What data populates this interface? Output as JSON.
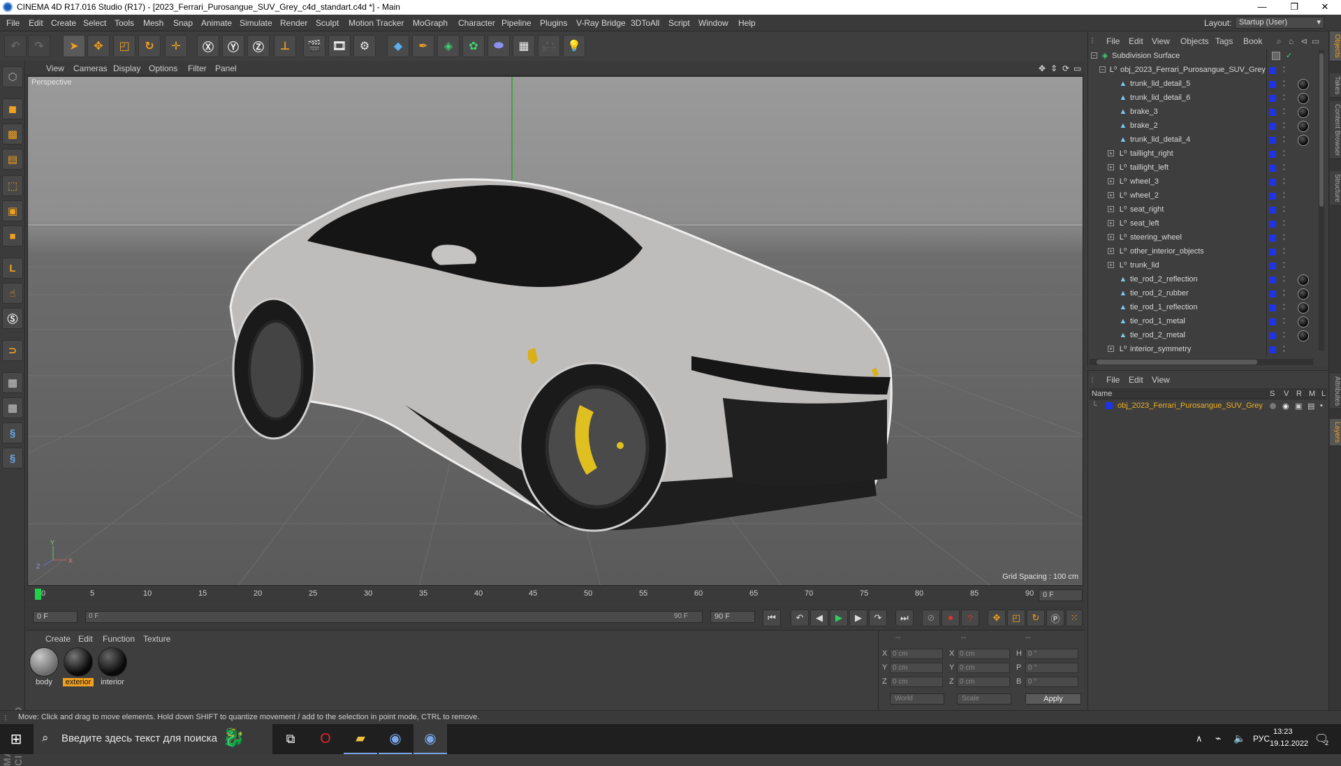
{
  "window": {
    "title": "CINEMA 4D R17.016 Studio (R17) - [2023_Ferrari_Purosangue_SUV_Grey_c4d_standart.c4d *] - Main",
    "minimize": "—",
    "maximize": "❐",
    "close": "✕"
  },
  "menu": [
    "File",
    "Edit",
    "Create",
    "Select",
    "Tools",
    "Mesh",
    "Snap",
    "Animate",
    "Simulate",
    "Render",
    "Sculpt",
    "Motion Tracker",
    "MoGraph",
    "Character",
    "Pipeline",
    "Plugins",
    "V-Ray Bridge",
    "3DToAll",
    "Script",
    "Window",
    "Help"
  ],
  "layout": {
    "label": "Layout:",
    "value": "Startup (User)"
  },
  "viewport": {
    "menu": [
      "View",
      "Cameras",
      "Display",
      "Options",
      "Filter",
      "Panel"
    ],
    "label": "Perspective",
    "grid_spacing": "Grid Spacing : 100 cm",
    "axis_y": "Y",
    "axis_x": "X",
    "axis_z": "Z"
  },
  "timeline": {
    "ticks": [
      "0",
      "5",
      "10",
      "15",
      "20",
      "25",
      "30",
      "35",
      "40",
      "45",
      "50",
      "55",
      "60",
      "65",
      "70",
      "75",
      "80",
      "85",
      "90"
    ],
    "current_frame": "0 F",
    "start_frame": "0 F",
    "range_start": "0 F",
    "range_end": "90 F",
    "end_frame": "90 F"
  },
  "materials": {
    "menu": [
      "Create",
      "Edit",
      "Function",
      "Texture"
    ],
    "items": [
      {
        "name": "body",
        "selected": false
      },
      {
        "name": "exterior",
        "selected": true
      },
      {
        "name": "interior",
        "selected": false
      }
    ]
  },
  "coordinates": {
    "header": [
      "--",
      "--",
      "--"
    ],
    "rows": [
      {
        "a": "X",
        "av": "0 cm",
        "b": "X",
        "bv": "0 cm",
        "c": "H",
        "cv": "0 °"
      },
      {
        "a": "Y",
        "av": "0 cm",
        "b": "Y",
        "bv": "0 cm",
        "c": "P",
        "cv": "0 °"
      },
      {
        "a": "Z",
        "av": "0 cm",
        "b": "Z",
        "bv": "0 cm",
        "c": "B",
        "cv": "0 °"
      }
    ],
    "mode": "World",
    "scale": "Scale",
    "apply": "Apply"
  },
  "status": "Move: Click and drag to move elements. Hold down SHIFT to quantize movement / add to the selection in point mode, CTRL to remove.",
  "object_manager": {
    "menu": [
      "File",
      "Edit",
      "View",
      "Objects",
      "Tags",
      "Book"
    ],
    "rows": [
      {
        "name": "Subdivision Surface",
        "indent": 0,
        "type": "subd",
        "expand": "−",
        "tag": false
      },
      {
        "name": "obj_2023_Ferrari_Purosangue_SUV_Grey",
        "indent": 1,
        "type": "null",
        "expand": "−",
        "tag": false
      },
      {
        "name": "trunk_lid_detail_5",
        "indent": 2,
        "type": "poly",
        "expand": "",
        "tag": true
      },
      {
        "name": "trunk_lid_detail_6",
        "indent": 2,
        "type": "poly",
        "expand": "",
        "tag": true
      },
      {
        "name": "brake_3",
        "indent": 2,
        "type": "poly",
        "expand": "",
        "tag": true
      },
      {
        "name": "brake_2",
        "indent": 2,
        "type": "poly",
        "expand": "",
        "tag": true
      },
      {
        "name": "trunk_lid_detail_4",
        "indent": 2,
        "type": "poly",
        "expand": "",
        "tag": true
      },
      {
        "name": "taillight_right",
        "indent": 2,
        "type": "null",
        "expand": "+",
        "tag": false
      },
      {
        "name": "taillight_left",
        "indent": 2,
        "type": "null",
        "expand": "+",
        "tag": false
      },
      {
        "name": "wheel_3",
        "indent": 2,
        "type": "null",
        "expand": "+",
        "tag": false
      },
      {
        "name": "wheel_2",
        "indent": 2,
        "type": "null",
        "expand": "+",
        "tag": false
      },
      {
        "name": "seat_right",
        "indent": 2,
        "type": "null",
        "expand": "+",
        "tag": false
      },
      {
        "name": "seat_left",
        "indent": 2,
        "type": "null",
        "expand": "+",
        "tag": false
      },
      {
        "name": "steering_wheel",
        "indent": 2,
        "type": "null",
        "expand": "+",
        "tag": false
      },
      {
        "name": "other_interior_objects",
        "indent": 2,
        "type": "null",
        "expand": "+",
        "tag": false
      },
      {
        "name": "trunk_lid",
        "indent": 2,
        "type": "null",
        "expand": "+",
        "tag": false
      },
      {
        "name": "tie_rod_2_reflection",
        "indent": 2,
        "type": "poly",
        "expand": "",
        "tag": true
      },
      {
        "name": "tie_rod_2_rubber",
        "indent": 2,
        "type": "poly",
        "expand": "",
        "tag": true
      },
      {
        "name": "tie_rod_1_reflection",
        "indent": 2,
        "type": "poly",
        "expand": "",
        "tag": true
      },
      {
        "name": "tie_rod_1_metal",
        "indent": 2,
        "type": "poly",
        "expand": "",
        "tag": true
      },
      {
        "name": "tie_rod_2_metal",
        "indent": 2,
        "type": "poly",
        "expand": "",
        "tag": true
      },
      {
        "name": "interior_symmetry",
        "indent": 2,
        "type": "null",
        "expand": "+",
        "tag": false
      }
    ]
  },
  "layer_manager": {
    "menu": [
      "File",
      "Edit",
      "View"
    ],
    "columns": {
      "name": "Name",
      "s": "S",
      "v": "V",
      "r": "R",
      "m": "M",
      "l": "L"
    },
    "layer": "obj_2023_Ferrari_Purosangue_SUV_Grey"
  },
  "side_tabs": [
    "Objects",
    "Takes",
    "Content Browser",
    "Structure",
    "Attributes",
    "Layers"
  ],
  "taskbar": {
    "search_placeholder": "Введите здесь текст для поиска",
    "lang": "РУС",
    "time": "13:23",
    "date": "19.12.2022",
    "notifications": "2"
  },
  "colors": {
    "accent": "#f0a020",
    "layer_blue": "#1e33e8",
    "playhead": "#1ed34a",
    "selected_material": "#f0a020"
  }
}
